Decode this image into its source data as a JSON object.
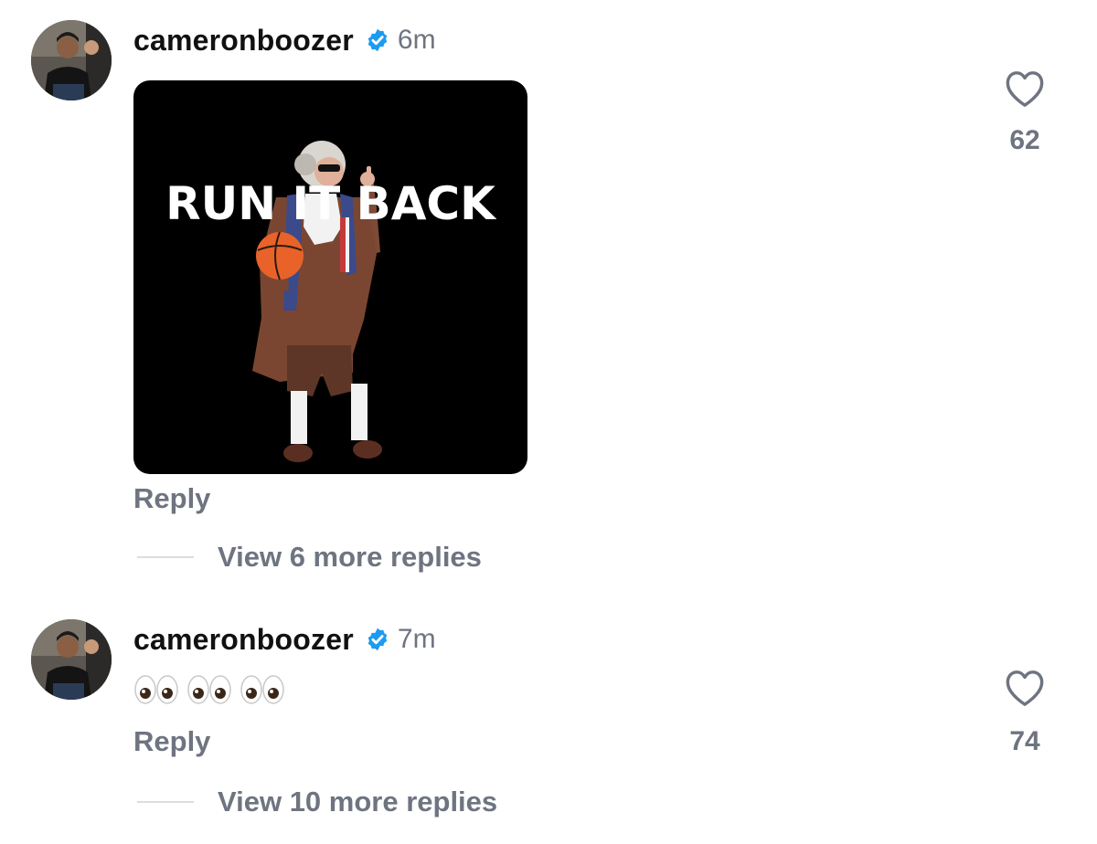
{
  "comments": [
    {
      "username": "cameronboozer",
      "time": "6m",
      "gif_caption": "RUN IT BACK",
      "reply_label": "Reply",
      "view_more": "View 6 more replies",
      "likes": "62"
    },
    {
      "username": "cameronboozer",
      "time": "7m",
      "emoji_text": "eyes eyes eyes",
      "reply_label": "Reply",
      "view_more": "View 10 more replies",
      "likes": "74"
    }
  ],
  "colors": {
    "verified": "#1d9bf0",
    "muted": "#6e7480",
    "text": "#111111"
  },
  "icons": {
    "verified": "verified-badge-icon",
    "like": "heart-outline-icon"
  }
}
